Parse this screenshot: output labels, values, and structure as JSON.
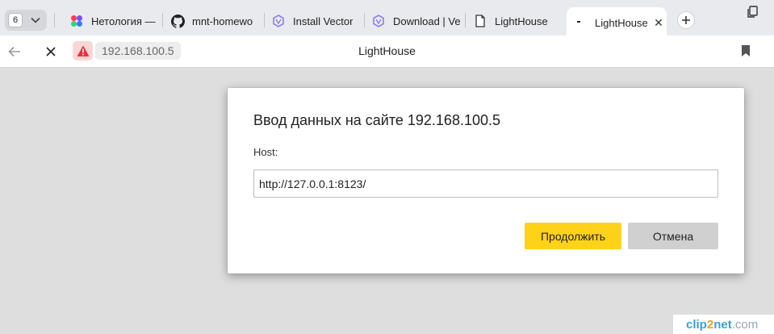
{
  "browser": {
    "tab_count": "6",
    "tabs": [
      {
        "title": "Нетология —",
        "icon": "netology-logo-icon"
      },
      {
        "title": "mnt-homewo",
        "icon": "github-icon"
      },
      {
        "title": "Install Vector",
        "icon": "vector-logo-icon"
      },
      {
        "title": "Download | Ve",
        "icon": "vector-logo-icon"
      },
      {
        "title": "LightHouse",
        "icon": "page-icon"
      },
      {
        "title": "LightHouse",
        "icon": "loading-icon",
        "active": true
      }
    ],
    "address": "192.168.100.5",
    "page_title": "LightHouse"
  },
  "dialog": {
    "title": "Ввод данных на сайте 192.168.100.5",
    "label": "Host:",
    "input_value": "http://127.0.0.1:8123/",
    "ok_label": "Продолжить",
    "cancel_label": "Отмена"
  },
  "watermark": {
    "part1": "clip",
    "part2": "2",
    "part3": "net",
    "part4": ".com"
  },
  "colors": {
    "accent_button": "#ffd21a",
    "cancel_button": "#d0d0d0",
    "page_background": "#dedede",
    "warning": "#e3343a"
  }
}
